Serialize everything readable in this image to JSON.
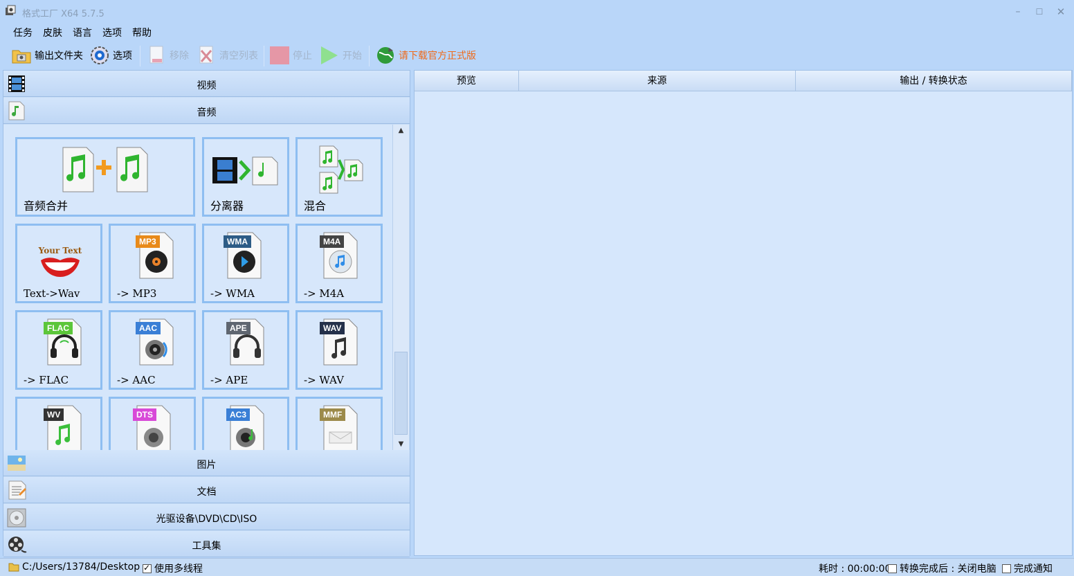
{
  "app": {
    "title": "格式工厂 X64 5.7.5"
  },
  "menu": {
    "items": [
      "任务",
      "皮肤",
      "语言",
      "选项",
      "帮助"
    ]
  },
  "toolbar": {
    "output_folder": "输出文件夹",
    "options": "选项",
    "remove": "移除",
    "clear_list": "清空列表",
    "stop": "停止",
    "start": "开始",
    "download_official": "请下载官方正式版"
  },
  "left": {
    "categories": {
      "video": "视频",
      "audio": "音频",
      "image": "图片",
      "document": "文档",
      "optical": "光驱设备\\DVD\\CD\\ISO",
      "tools": "工具集"
    },
    "tiles": {
      "audio_merge": "音频合并",
      "separator": "分离器",
      "mix": "混合",
      "text_wav": "Text->Wav",
      "mp3": "-> MP3",
      "wma": "-> WMA",
      "m4a": "-> M4A",
      "flac": "-> FLAC",
      "aac": "-> AAC",
      "ape": "-> APE",
      "wav": "-> WAV"
    },
    "badges": {
      "mp3": "MP3",
      "wma": "WMA",
      "m4a": "M4A",
      "flac": "FLAC",
      "aac": "AAC",
      "ape": "APE",
      "wav": "WAV",
      "wv": "WV",
      "dts": "DTS",
      "ac3": "AC3",
      "mmf": "MMF"
    },
    "your_text": "Your Text"
  },
  "table": {
    "columns": [
      "预览",
      "来源",
      "输出 / 转换状态"
    ]
  },
  "status": {
    "path": "C:/Users/13784/Desktop",
    "multithread": "使用多线程",
    "elapsed": "耗时 : 00:00:00",
    "after_convert": "转换完成后 : 关闭电脑",
    "notify": "完成通知"
  },
  "colors": {
    "window_bg": "#b9d6f9",
    "tile_border": "#8ebef1",
    "accent_orange": "#ee6a1a"
  }
}
